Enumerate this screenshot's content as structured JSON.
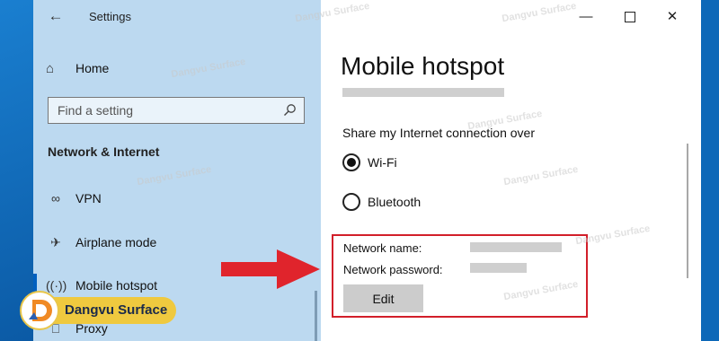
{
  "window": {
    "title": "Settings",
    "controls": [
      "minimize",
      "maximize",
      "close"
    ]
  },
  "nav": {
    "home_label": "Home",
    "search_placeholder": "Find a setting",
    "section_title": "Network & Internet",
    "items": [
      {
        "label": "VPN",
        "icon": "vpn-icon"
      },
      {
        "label": "Airplane mode",
        "icon": "airplane-icon"
      },
      {
        "label": "Mobile hotspot",
        "icon": "hotspot-icon",
        "active": true
      },
      {
        "label": "Proxy",
        "icon": "proxy-icon"
      }
    ]
  },
  "content": {
    "page_title": "Mobile hotspot",
    "share_label": "Share my Internet connection over",
    "options": [
      {
        "label": "Wi-Fi",
        "checked": true
      },
      {
        "label": "Bluetooth",
        "checked": false
      }
    ],
    "network_name_label": "Network name:",
    "network_password_label": "Network password:",
    "edit_label": "Edit"
  },
  "overlay": {
    "brand": "Dangvu Surface",
    "watermark": "Dangvu Surface",
    "highlight_color": "#d21f2a",
    "arrow_color": "#e0242c",
    "brand_color": "#efc93f"
  },
  "colors": {
    "nav_background": "#bcd9f0",
    "content_background": "#ffffff",
    "desktop": "#0d68b8"
  }
}
